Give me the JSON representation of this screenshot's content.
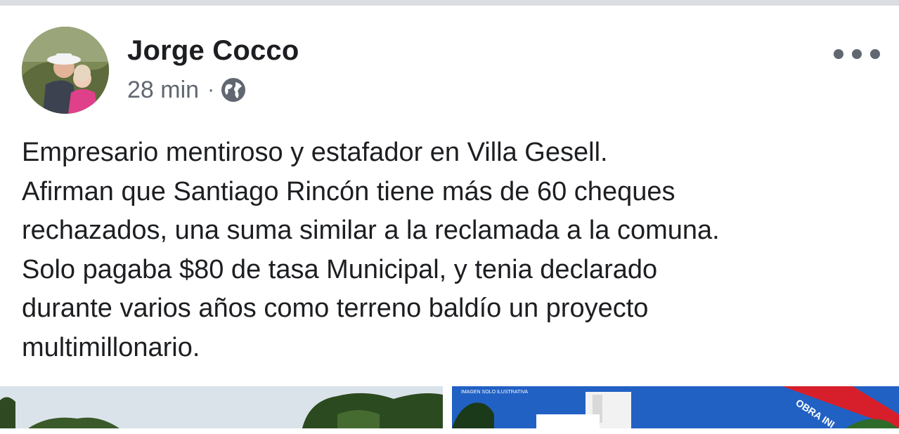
{
  "post": {
    "author": "Jorge Cocco",
    "timestamp": "28 min",
    "separator": "·",
    "privacy_icon": "globe-icon",
    "more_icon": "more-options-icon",
    "text_lines": [
      "Empresario mentiroso y estafador en Villa Gesell.",
      "Afirman que Santiago Rincón tiene más de 60 cheques",
      "rechazados, una suma similar a la reclamada a la comuna.",
      "Solo pagaba $80 de tasa Municipal, y tenia declarado",
      "durante varios años como terreno baldío un proyecto",
      "multimillonario."
    ]
  },
  "photos": {
    "second_banner": "OBRA INI",
    "second_caption": "IMAGEN SOLO ILUSTRATIVA"
  },
  "colors": {
    "primary_text": "#1c1e21",
    "secondary_text": "#606770",
    "divider": "#dadde1"
  }
}
